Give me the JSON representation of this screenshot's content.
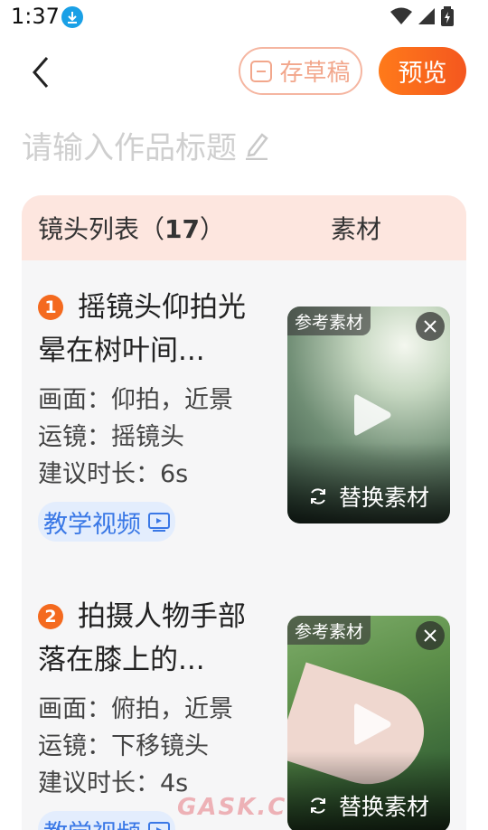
{
  "status_bar": {
    "time": "1:37"
  },
  "toolbar": {
    "draft_label": "存草稿",
    "preview_label": "预览"
  },
  "title_input": {
    "placeholder": "请输入作品标题"
  },
  "shot_list": {
    "header_label": "镜头列表（",
    "count": "17",
    "header_close": "）",
    "material_label": "素材"
  },
  "shots": [
    {
      "number": "1",
      "title": "摇镜头仰拍光晕在树叶间...",
      "scene": "画面：仰拍，近景",
      "camera": "运镜：摇镜头",
      "duration": "建议时长：6s",
      "tutorial_label": "教学视频",
      "ref_tag": "参考素材",
      "replace_label": "替换素材"
    },
    {
      "number": "2",
      "title": "拍摄人物手部落在膝上的...",
      "scene": "画面：俯拍，近景",
      "camera": "运镜：下移镜头",
      "duration": "建议时长：4s",
      "tutorial_label": "教学视频",
      "ref_tag": "参考素材",
      "replace_label": "替换素材"
    }
  ],
  "watermark": "GASK.C",
  "colors": {
    "accent": "#f4571f",
    "tag_blue": "#3a78e6",
    "header_bg": "#fde6df"
  }
}
